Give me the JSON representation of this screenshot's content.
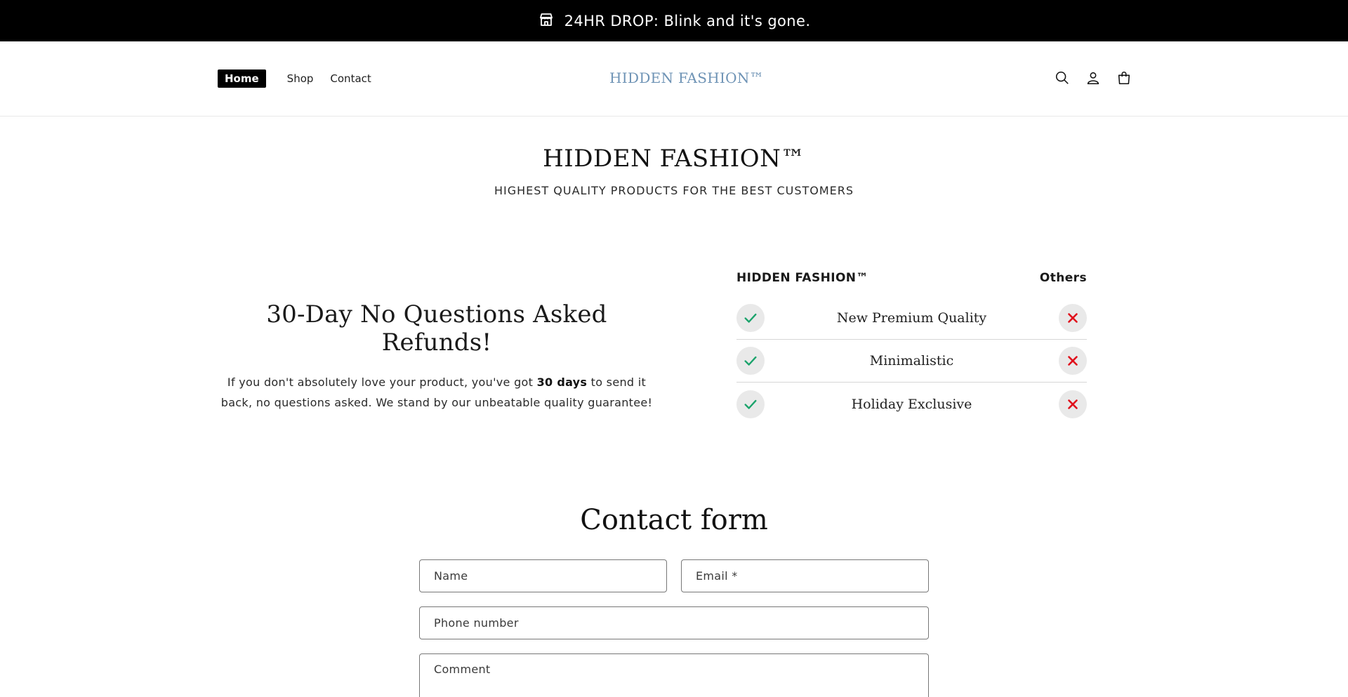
{
  "announcement": {
    "text": "24HR DROP: Blink and it's gone.",
    "icon": "store-icon"
  },
  "header": {
    "nav": [
      {
        "label": "Home",
        "active": true
      },
      {
        "label": "Shop",
        "active": false
      },
      {
        "label": "Contact",
        "active": false
      }
    ],
    "logo": "HIDDEN FASHION™",
    "icons": [
      "search-icon",
      "account-icon",
      "cart-icon"
    ]
  },
  "hero": {
    "title": "HIDDEN FASHION™",
    "subtitle": "HIGHEST QUALITY PRODUCTS FOR THE BEST CUSTOMERS"
  },
  "refund": {
    "heading": "30-Day No Questions Asked Refunds!",
    "text_before": "If you don't absolutely love your product, you've got ",
    "text_bold": "30 days",
    "text_after": " to send it back, no questions asked. We stand by our unbeatable quality guarantee!"
  },
  "comparison": {
    "brand_label": "HIDDEN FASHION™",
    "others_label": "Others",
    "rows": [
      {
        "feature": "New Premium Quality"
      },
      {
        "feature": "Minimalistic"
      },
      {
        "feature": "Holiday Exclusive"
      }
    ],
    "colors": {
      "check": "#1aa36b",
      "cross": "#e0101c"
    }
  },
  "contact": {
    "heading": "Contact form",
    "name_placeholder": "Name",
    "email_placeholder": "Email *",
    "phone_placeholder": "Phone number",
    "comment_placeholder": "Comment"
  }
}
